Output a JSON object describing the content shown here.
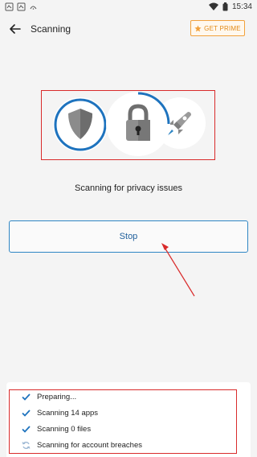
{
  "status_bar": {
    "left_icons": [
      "app-notification-icon",
      "app-notification-icon",
      "signal-alert-icon"
    ],
    "time": "15:34"
  },
  "app_bar": {
    "title": "Scanning",
    "prime_label": "GET PRIME"
  },
  "scan": {
    "caption": "Scanning for privacy issues",
    "stop_label": "Stop"
  },
  "steps": [
    {
      "label": "Preparing...",
      "state": "done"
    },
    {
      "label": "Scanning 14 apps",
      "state": "done"
    },
    {
      "label": "Scanning 0 files",
      "state": "done"
    },
    {
      "label": "Scanning for account breaches",
      "state": "in-progress"
    }
  ],
  "colors": {
    "accent_blue": "#1e73be",
    "prime_orange": "#f2a13b",
    "highlight_red": "#d92b2b"
  }
}
